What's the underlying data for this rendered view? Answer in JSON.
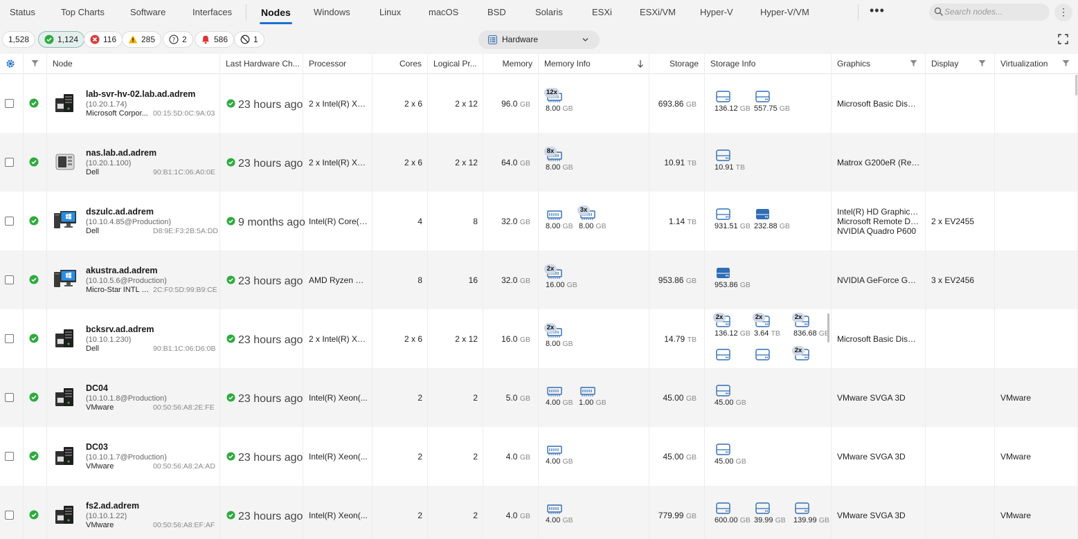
{
  "tabs": [
    "Status",
    "Top Charts",
    "Software",
    "Interfaces",
    "Nodes",
    "Windows",
    "Linux",
    "macOS",
    "BSD",
    "Solaris",
    "ESXi",
    "ESXi/VM",
    "Hyper-V",
    "Hyper-V/VM"
  ],
  "active_tab": "Nodes",
  "more_label": "•••",
  "search_placeholder": "Search nodes...",
  "filters": {
    "total": "1,528",
    "ok": "1,124",
    "error": "116",
    "warning": "285",
    "unknown": "2",
    "alarm": "586",
    "disabled": "1"
  },
  "view_select": "Hardware",
  "colors": {
    "accent": "#1a6fd1",
    "ok": "#2eaa3f",
    "error": "#d83b3b",
    "warning": "#f2b200",
    "alarm": "#e23030",
    "module": "#2f6db5"
  },
  "columns": {
    "node": "Node",
    "last_change": "Last Hardware Ch...",
    "processor": "Processor",
    "cores": "Cores",
    "logical": "Logical Pr...",
    "memory": "Memory",
    "memory_info": "Memory Info",
    "storage": "Storage",
    "storage_info": "Storage Info",
    "graphics": "Graphics",
    "display": "Display",
    "virtualization": "Virtualization"
  },
  "rows": [
    {
      "name": "lab-svr-hv-02.lab.ad.adrem",
      "ip": "(10.20.1.74)",
      "vendor": "Microsoft Corpor...",
      "mac": "00:15:5D:0C:9A:03",
      "device": "server",
      "last": "23 hours ago",
      "processor": "2 x Intel(R) Xe...",
      "cores": "2 x 6",
      "logical": "2 x 12",
      "memory": "96.0",
      "memory_unit": "GB",
      "mem_modules": [
        {
          "count": "12x",
          "size": "8.00",
          "unit": "GB"
        }
      ],
      "storage": "693.86",
      "storage_unit": "GB",
      "storage_modules": [
        {
          "count": "",
          "size": "136.12",
          "unit": "GB",
          "type": "hdd"
        },
        {
          "count": "",
          "size": "557.75",
          "unit": "GB",
          "type": "hdd"
        }
      ],
      "graphics": [
        "Microsoft Basic Displ..."
      ],
      "display": "",
      "virtualization": ""
    },
    {
      "name": "nas.lab.ad.adrem",
      "ip": "(10.20.1.100)",
      "vendor": "Dell",
      "mac": "90:B1:1C:06:A0:0E",
      "device": "nas",
      "last": "23 hours ago",
      "processor": "2 x Intel(R) Xe...",
      "cores": "2 x 6",
      "logical": "2 x 12",
      "memory": "64.0",
      "memory_unit": "GB",
      "mem_modules": [
        {
          "count": "8x",
          "size": "8.00",
          "unit": "GB"
        }
      ],
      "storage": "10.91",
      "storage_unit": "TB",
      "storage_modules": [
        {
          "count": "",
          "size": "10.91",
          "unit": "TB",
          "type": "hdd"
        }
      ],
      "graphics": [
        "Matrox G200eR (Ren..."
      ],
      "display": "",
      "virtualization": ""
    },
    {
      "name": "dszulc.ad.adrem",
      "ip": "(10.10.4.85@Production)",
      "vendor": "Dell",
      "mac": "D8:9E:F3:2B:5A:DD",
      "device": "desktop",
      "last": "9 months ago",
      "processor": "Intel(R) Core(T...",
      "cores": "4",
      "logical": "8",
      "memory": "32.0",
      "memory_unit": "GB",
      "mem_modules": [
        {
          "count": "",
          "size": "8.00",
          "unit": "GB"
        },
        {
          "count": "3x",
          "size": "8.00",
          "unit": "GB"
        }
      ],
      "storage": "1.14",
      "storage_unit": "TB",
      "storage_modules": [
        {
          "count": "",
          "size": "931.51",
          "unit": "GB",
          "type": "hdd"
        },
        {
          "count": "",
          "size": "232.88",
          "unit": "GB",
          "type": "ssd"
        }
      ],
      "graphics": [
        "Intel(R) HD Graphics ...",
        "Microsoft Remote Dis...",
        "NVIDIA Quadro P600"
      ],
      "display": "2 x EV2455",
      "virtualization": ""
    },
    {
      "name": "akustra.ad.adrem",
      "ip": "(10.10.5.6@Production)",
      "vendor": "Micro-Star INTL C...",
      "mac": "2C:F0:5D:99:B9:CE",
      "device": "desktop",
      "last": "23 hours ago",
      "processor": "AMD Ryzen 7 ...",
      "cores": "8",
      "logical": "16",
      "memory": "32.0",
      "memory_unit": "GB",
      "mem_modules": [
        {
          "count": "2x",
          "size": "16.00",
          "unit": "GB"
        }
      ],
      "storage": "953.86",
      "storage_unit": "GB",
      "storage_modules": [
        {
          "count": "",
          "size": "953.86",
          "unit": "GB",
          "type": "ssd"
        }
      ],
      "graphics": [
        "NVIDIA GeForce GTX ..."
      ],
      "display": "3 x EV2456",
      "virtualization": ""
    },
    {
      "name": "bcksrv.ad.adrem",
      "ip": "(10.10.1.230)",
      "vendor": "Dell",
      "mac": "90:B1:1C:06:D6:0B",
      "device": "server",
      "last": "23 hours ago",
      "processor": "2 x Intel(R) Xe...",
      "cores": "2 x 6",
      "logical": "2 x 12",
      "memory": "16.0",
      "memory_unit": "GB",
      "mem_modules": [
        {
          "count": "2x",
          "size": "8.00",
          "unit": "GB"
        }
      ],
      "storage": "14.79",
      "storage_unit": "TB",
      "storage_modules": [
        {
          "count": "2x",
          "size": "136.12",
          "unit": "GB",
          "type": "hdd"
        },
        {
          "count": "2x",
          "size": "3.64",
          "unit": "TB",
          "type": "hdd"
        },
        {
          "count": "2x",
          "size": "836.68",
          "unit": "GB",
          "type": "hdd"
        },
        {
          "count": "",
          "size": "",
          "unit": "",
          "type": "hdd"
        },
        {
          "count": "",
          "size": "",
          "unit": "",
          "type": "hdd"
        },
        {
          "count": "2x",
          "size": "",
          "unit": "",
          "type": "hdd"
        }
      ],
      "graphics": [
        "Microsoft Basic Displ..."
      ],
      "display": "",
      "virtualization": ""
    },
    {
      "name": "DC04",
      "ip": "(10.10.1.8@Production)",
      "vendor": "VMware",
      "mac": "00:50:56:A8:2E:FE",
      "device": "server",
      "last": "23 hours ago",
      "processor": "Intel(R) Xeon(...",
      "cores": "2",
      "logical": "2",
      "memory": "5.0",
      "memory_unit": "GB",
      "mem_modules": [
        {
          "count": "",
          "size": "4.00",
          "unit": "GB"
        },
        {
          "count": "",
          "size": "1.00",
          "unit": "GB"
        }
      ],
      "storage": "45.00",
      "storage_unit": "GB",
      "storage_modules": [
        {
          "count": "",
          "size": "45.00",
          "unit": "GB",
          "type": "hdd"
        }
      ],
      "graphics": [
        "VMware SVGA 3D"
      ],
      "display": "",
      "virtualization": "VMware"
    },
    {
      "name": "DC03",
      "ip": "(10.10.1.7@Production)",
      "vendor": "VMware",
      "mac": "00:50:56:A8:2A:AD",
      "device": "server",
      "last": "23 hours ago",
      "processor": "Intel(R) Xeon(...",
      "cores": "2",
      "logical": "2",
      "memory": "4.0",
      "memory_unit": "GB",
      "mem_modules": [
        {
          "count": "",
          "size": "4.00",
          "unit": "GB"
        }
      ],
      "storage": "45.00",
      "storage_unit": "GB",
      "storage_modules": [
        {
          "count": "",
          "size": "45.00",
          "unit": "GB",
          "type": "hdd"
        }
      ],
      "graphics": [
        "VMware SVGA 3D"
      ],
      "display": "",
      "virtualization": "VMware"
    },
    {
      "name": "fs2.ad.adrem",
      "ip": "(10.10.1.22)",
      "vendor": "VMware",
      "mac": "00:50:56:A8:EF:AF",
      "device": "server",
      "last": "23 hours ago",
      "processor": "Intel(R) Xeon(...",
      "cores": "2",
      "logical": "2",
      "memory": "4.0",
      "memory_unit": "GB",
      "mem_modules": [
        {
          "count": "",
          "size": "4.00",
          "unit": "GB"
        }
      ],
      "storage": "779.99",
      "storage_unit": "GB",
      "storage_modules": [
        {
          "count": "",
          "size": "600.00",
          "unit": "GB",
          "type": "hdd"
        },
        {
          "count": "",
          "size": "39.99",
          "unit": "GB",
          "type": "hdd"
        },
        {
          "count": "",
          "size": "139.99",
          "unit": "GB",
          "type": "hdd"
        }
      ],
      "graphics": [
        "VMware SVGA 3D"
      ],
      "display": "",
      "virtualization": "VMware"
    }
  ]
}
